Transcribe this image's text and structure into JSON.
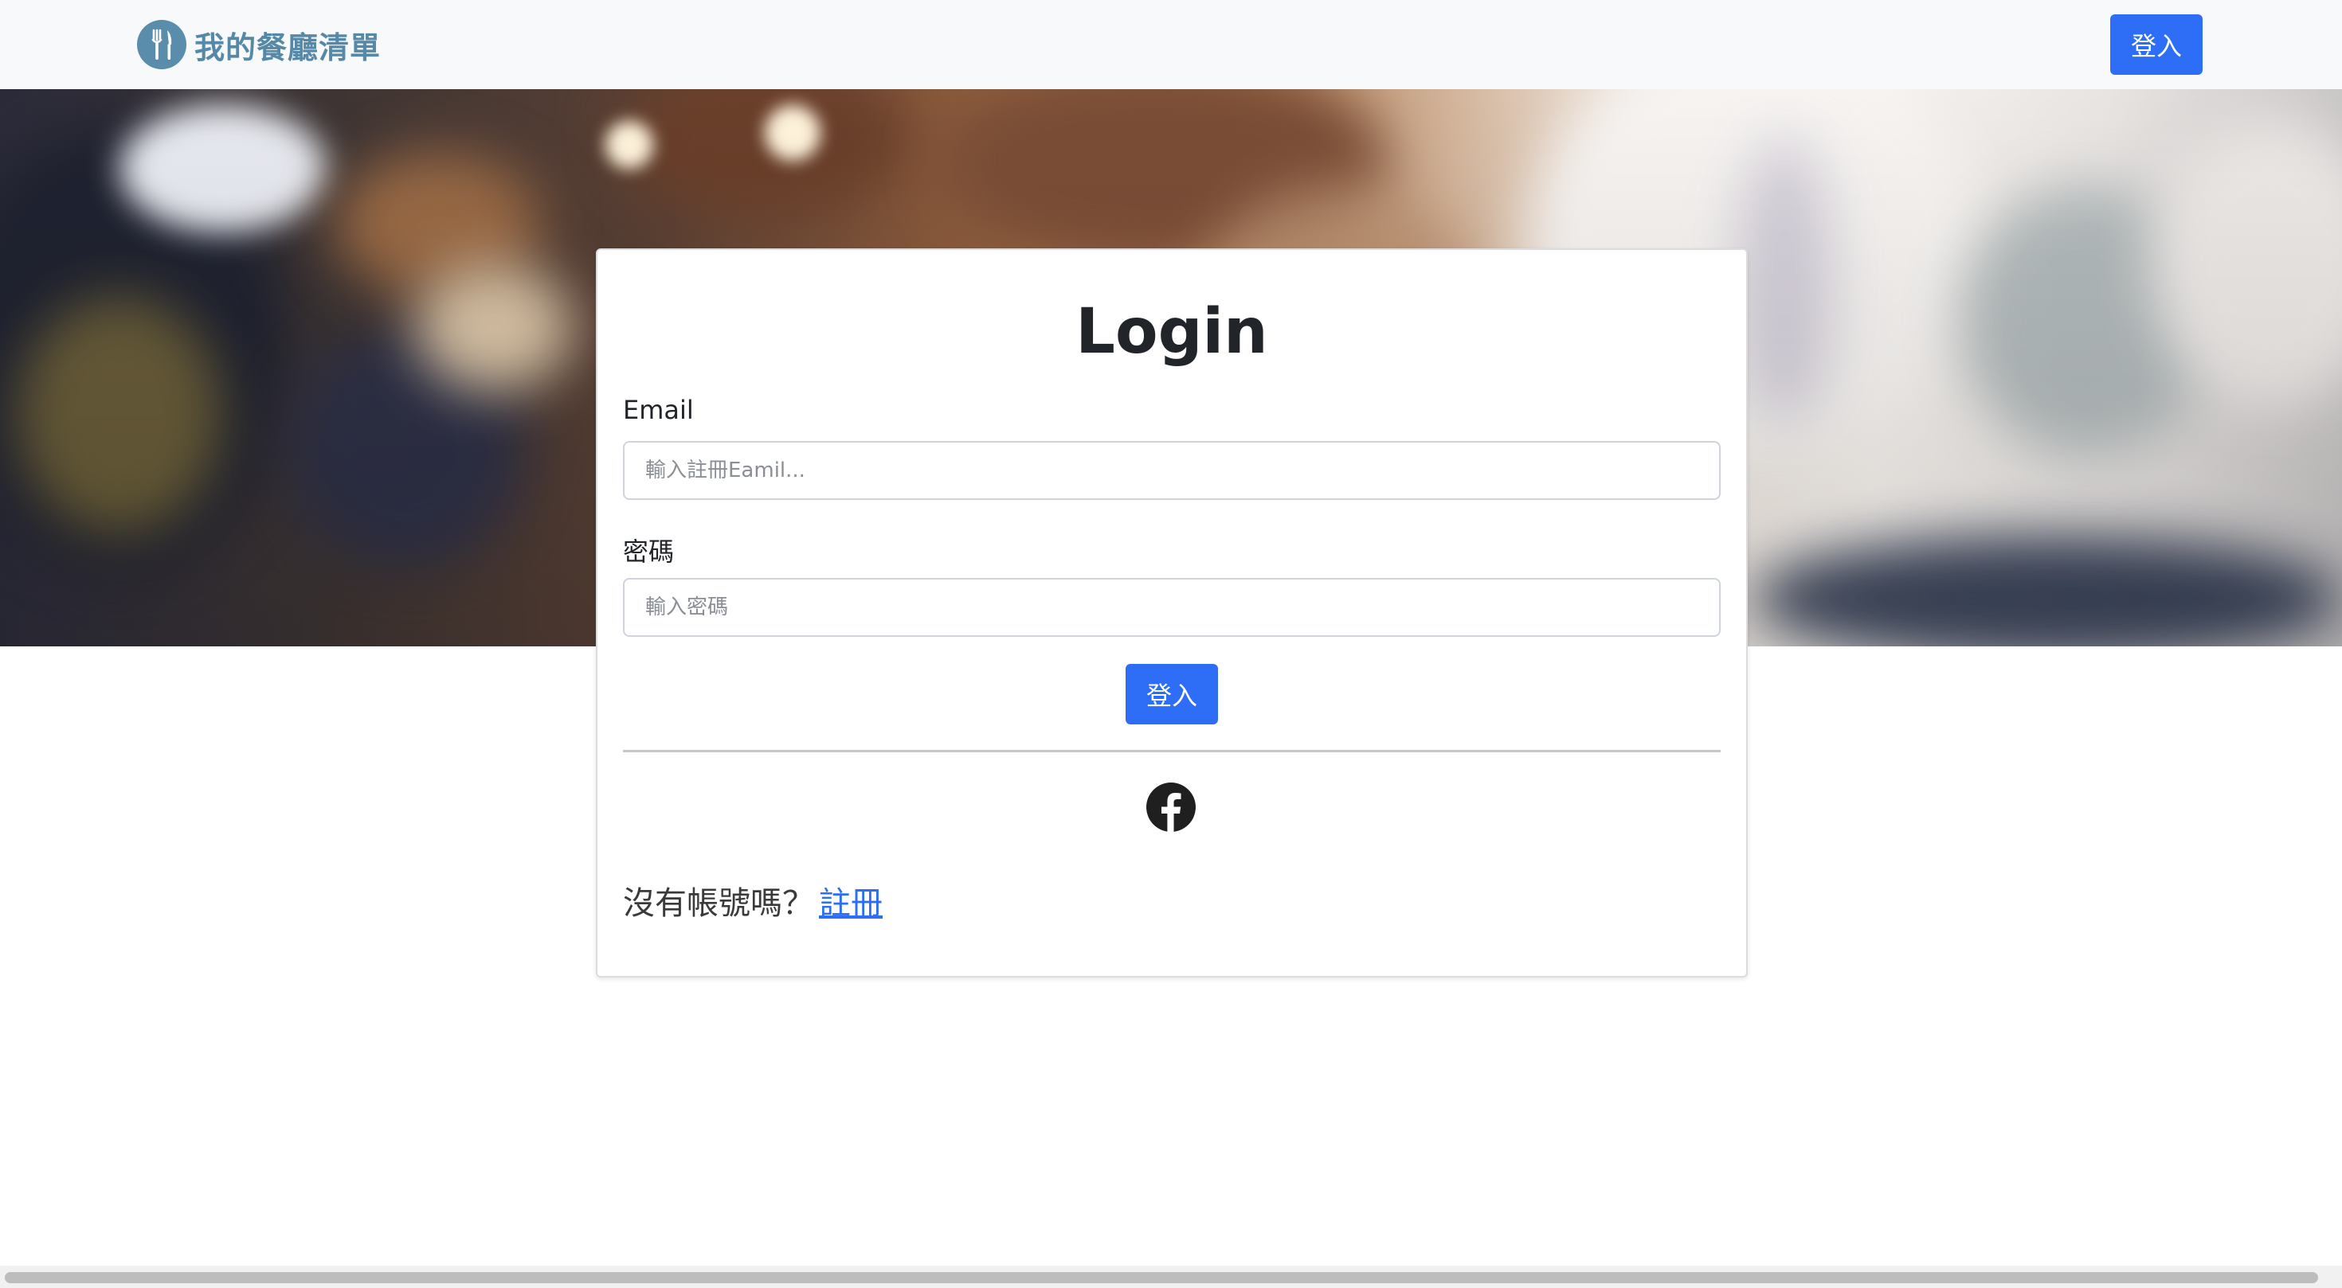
{
  "navbar": {
    "brand_text": "我的餐廳清單",
    "brand_icon": "utensils-icon",
    "login_label": "登入"
  },
  "login_card": {
    "title": "Login",
    "email_label": "Email",
    "email_placeholder": "輸入註冊Eamil...",
    "password_label": "密碼",
    "password_placeholder": "輸入密碼",
    "submit_label": "登入",
    "facebook_icon": "facebook-icon",
    "signup_prompt": "沒有帳號嗎？",
    "signup_link": "註冊"
  },
  "colors": {
    "primary": "#2e6ef7",
    "brand": "#5688a8",
    "navbar_bg": "#f8f9fa"
  }
}
